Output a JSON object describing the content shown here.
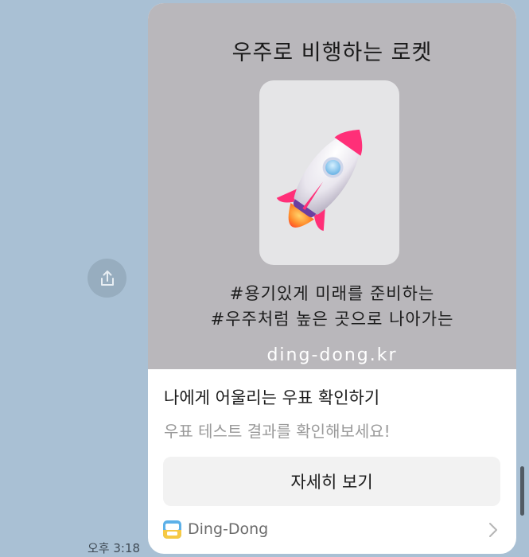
{
  "chat": {
    "timestamp": "오후 3:18",
    "share_icon": "share-icon"
  },
  "card": {
    "hero_title": "우주로 비행하는 로켓",
    "hashtags": [
      "#용기있게 미래를 준비하는",
      "#우주처럼 높은 곳으로 나아가는"
    ],
    "domain": "ding-dong.kr",
    "title": "나에게 어울리는 우표 확인하기",
    "subtitle": "우표 테스트 결과를 확인해보세요!",
    "button_label": "자세히 보기",
    "app_name": "Ding-Dong",
    "app_icon": "ding-dong-app-icon",
    "image_icon": "rocket-icon"
  },
  "colors": {
    "background": "#a9c0d4",
    "hero_background": "#b9b7bb",
    "rocket_pink": "#ff2f78"
  }
}
